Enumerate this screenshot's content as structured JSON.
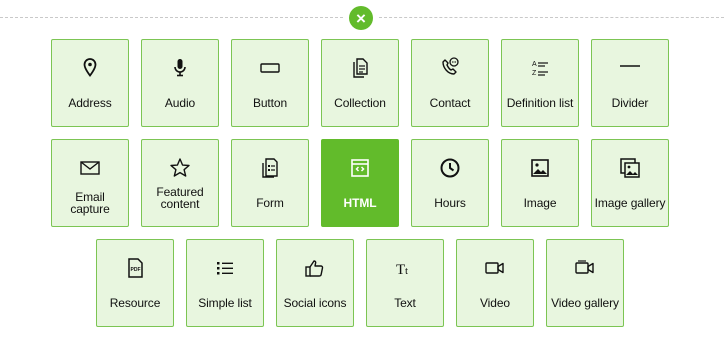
{
  "close": {
    "label": "×"
  },
  "tiles": [
    {
      "label": "Address",
      "icon": "location-pin-icon"
    },
    {
      "label": "Audio",
      "icon": "microphone-icon"
    },
    {
      "label": "Button",
      "icon": "button-rectangle-icon"
    },
    {
      "label": "Collection",
      "icon": "collection-documents-icon"
    },
    {
      "label": "Contact",
      "icon": "phone-chat-icon"
    },
    {
      "label": "Definition list",
      "icon": "definition-list-icon"
    },
    {
      "label": "Divider",
      "icon": "divider-line-icon"
    },
    {
      "label": "Email capture",
      "icon": "envelope-icon"
    },
    {
      "label": "Featured content",
      "icon": "star-icon"
    },
    {
      "label": "Form",
      "icon": "form-document-icon"
    },
    {
      "label": "HTML",
      "icon": "html-code-icon",
      "active": true
    },
    {
      "label": "Hours",
      "icon": "clock-icon"
    },
    {
      "label": "Image",
      "icon": "image-icon"
    },
    {
      "label": "Image gallery",
      "icon": "image-gallery-icon"
    },
    {
      "label": "Resource",
      "icon": "pdf-file-icon"
    },
    {
      "label": "Simple list",
      "icon": "bullet-list-icon"
    },
    {
      "label": "Social icons",
      "icon": "thumbs-up-icon"
    },
    {
      "label": "Text",
      "icon": "text-tt-icon"
    },
    {
      "label": "Video",
      "icon": "video-camera-icon"
    },
    {
      "label": "Video gallery",
      "icon": "video-gallery-icon"
    }
  ],
  "colors": {
    "accent": "#62bb2b",
    "tile_bg": "#e8f6df",
    "tile_border": "#7cc553"
  }
}
